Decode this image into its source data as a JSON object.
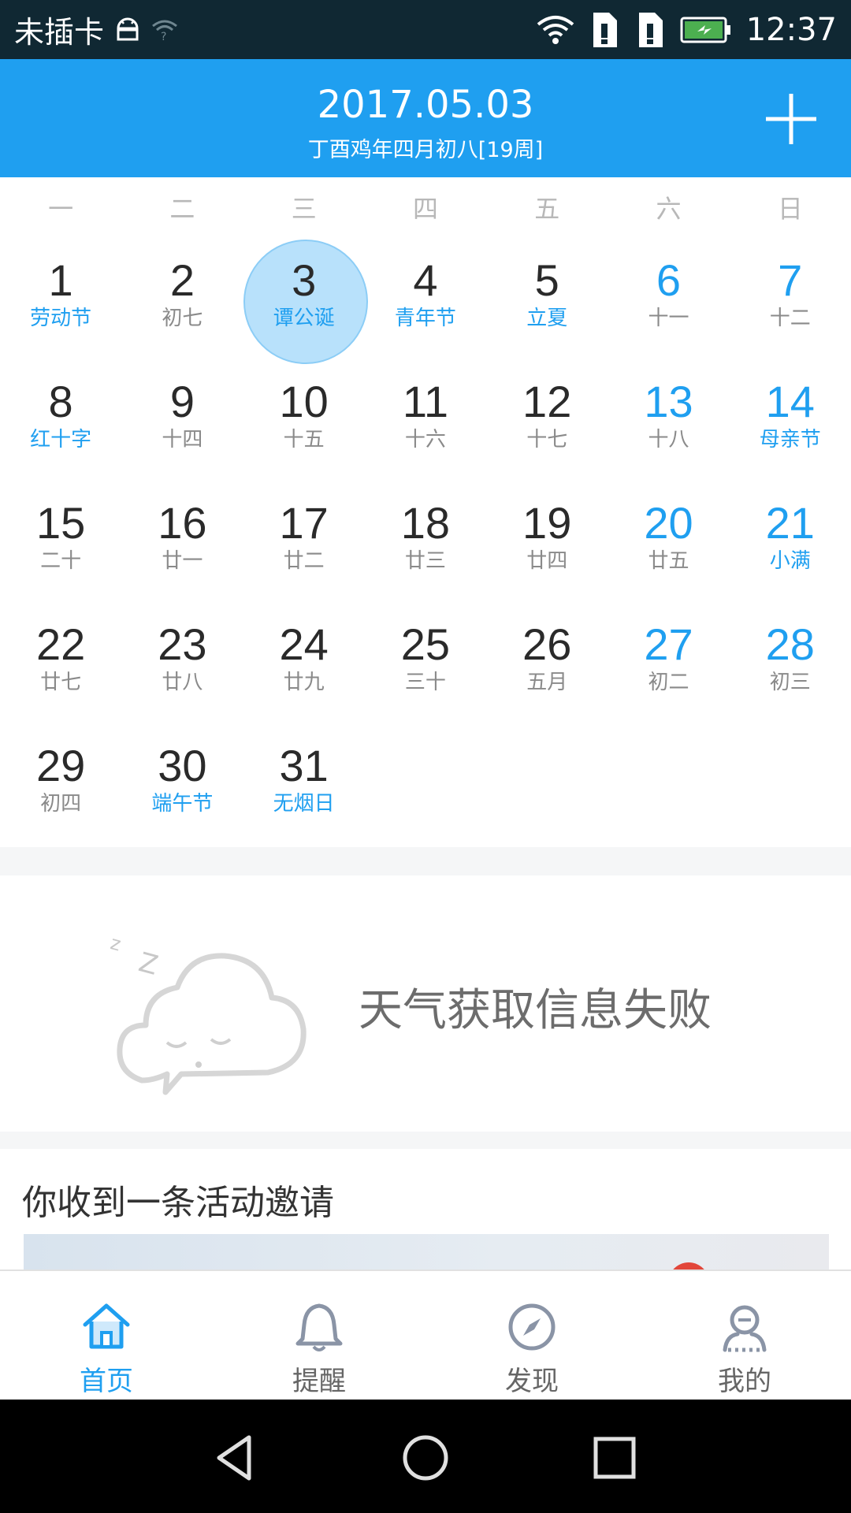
{
  "status_bar": {
    "carrier": "未插卡",
    "time": "12:37"
  },
  "header": {
    "date": "2017.05.03",
    "lunar": "丁酉鸡年四月初八[19周]"
  },
  "weekdays": [
    "一",
    "二",
    "三",
    "四",
    "五",
    "六",
    "日"
  ],
  "calendar": [
    {
      "day": "1",
      "sub": "劳动节",
      "fest": true
    },
    {
      "day": "2",
      "sub": "初七"
    },
    {
      "day": "3",
      "sub": "谭公诞",
      "fest": true,
      "today": true
    },
    {
      "day": "4",
      "sub": "青年节",
      "fest": true
    },
    {
      "day": "5",
      "sub": "立夏",
      "fest": true
    },
    {
      "day": "6",
      "sub": "十一",
      "weekend": true
    },
    {
      "day": "7",
      "sub": "十二",
      "weekend": true
    },
    {
      "day": "8",
      "sub": "红十字",
      "fest": true
    },
    {
      "day": "9",
      "sub": "十四"
    },
    {
      "day": "10",
      "sub": "十五"
    },
    {
      "day": "11",
      "sub": "十六"
    },
    {
      "day": "12",
      "sub": "十七"
    },
    {
      "day": "13",
      "sub": "十八",
      "weekend": true
    },
    {
      "day": "14",
      "sub": "母亲节",
      "weekend": true,
      "fest": true
    },
    {
      "day": "15",
      "sub": "二十"
    },
    {
      "day": "16",
      "sub": "廿一"
    },
    {
      "day": "17",
      "sub": "廿二"
    },
    {
      "day": "18",
      "sub": "廿三"
    },
    {
      "day": "19",
      "sub": "廿四"
    },
    {
      "day": "20",
      "sub": "廿五",
      "weekend": true
    },
    {
      "day": "21",
      "sub": "小满",
      "weekend": true,
      "fest": true
    },
    {
      "day": "22",
      "sub": "廿七"
    },
    {
      "day": "23",
      "sub": "廿八"
    },
    {
      "day": "24",
      "sub": "廿九"
    },
    {
      "day": "25",
      "sub": "三十"
    },
    {
      "day": "26",
      "sub": "五月"
    },
    {
      "day": "27",
      "sub": "初二",
      "weekend": true
    },
    {
      "day": "28",
      "sub": "初三",
      "weekend": true
    },
    {
      "day": "29",
      "sub": "初四"
    },
    {
      "day": "30",
      "sub": "端午节",
      "fest": true
    },
    {
      "day": "31",
      "sub": "无烟日",
      "fest": true
    }
  ],
  "weather": {
    "message": "天气获取信息失败",
    "zzz": "Z Z Z"
  },
  "invite": {
    "title": "你收到一条活动邀请"
  },
  "tabs": [
    {
      "label": "首页",
      "icon": "home-icon",
      "active": true
    },
    {
      "label": "提醒",
      "icon": "bell-icon"
    },
    {
      "label": "发现",
      "icon": "compass-icon"
    },
    {
      "label": "我的",
      "icon": "profile-icon"
    }
  ],
  "colors": {
    "accent": "#1f9ff0",
    "status_bar": "#102833",
    "today_circle": "#b8e1fb"
  }
}
